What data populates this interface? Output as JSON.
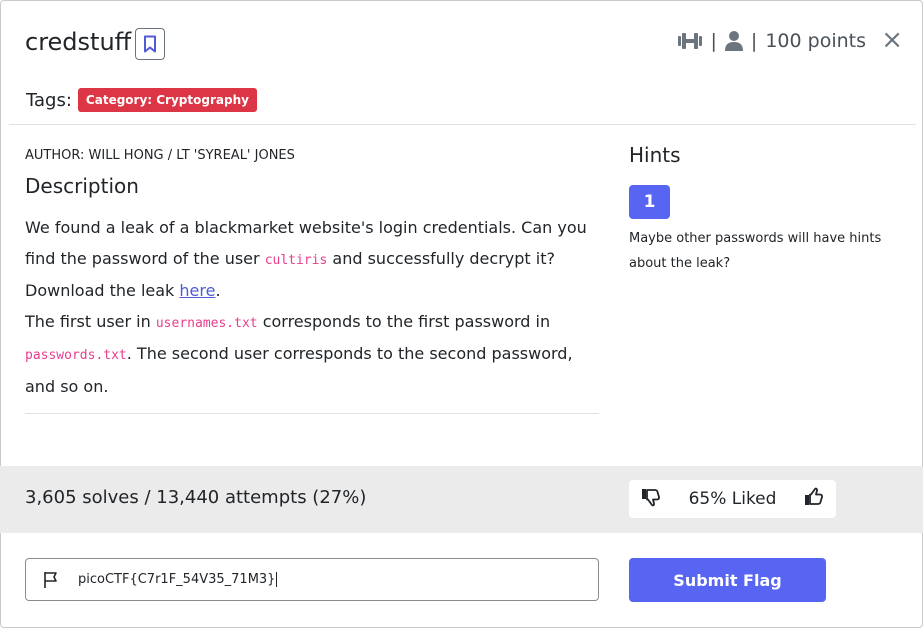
{
  "challenge": {
    "title": "credstuff",
    "points": "100 points",
    "separator": "|",
    "close": "×"
  },
  "tags": {
    "label": "Tags:",
    "category": "Category: Cryptography"
  },
  "author": "AUTHOR: WILL HONG / LT 'SYREAL' JONES",
  "description": {
    "heading": "Description",
    "line1_a": "We found a leak of a blackmarket website's login credentials. Can you find the password of the user ",
    "code_user": "cultiris",
    "line1_b": " and successfully decrypt it?",
    "line2_a": "Download the leak ",
    "link_here": "here",
    "line2_b": ".",
    "line3_a": "The first user in ",
    "code_usernames": "usernames.txt",
    "line3_b": " corresponds to the first password in ",
    "code_passwords": "passwords.txt",
    "line3_c": ". The second user corresponds to the second password, and so on."
  },
  "hints": {
    "heading": "Hints",
    "button": "1",
    "text": "Maybe other passwords will have hints about the leak?"
  },
  "stats": {
    "solves_text": "3,605 solves / 13,440 attempts (27%)",
    "liked_text": "65% Liked"
  },
  "flag": {
    "value": "picoCTF{C7r1F_54V35_71M3}",
    "submit_label": "Submit Flag"
  },
  "colors": {
    "accent": "#5865f2",
    "tag": "#dc3545",
    "code": "#e83e8c",
    "band": "#ebebeb"
  }
}
